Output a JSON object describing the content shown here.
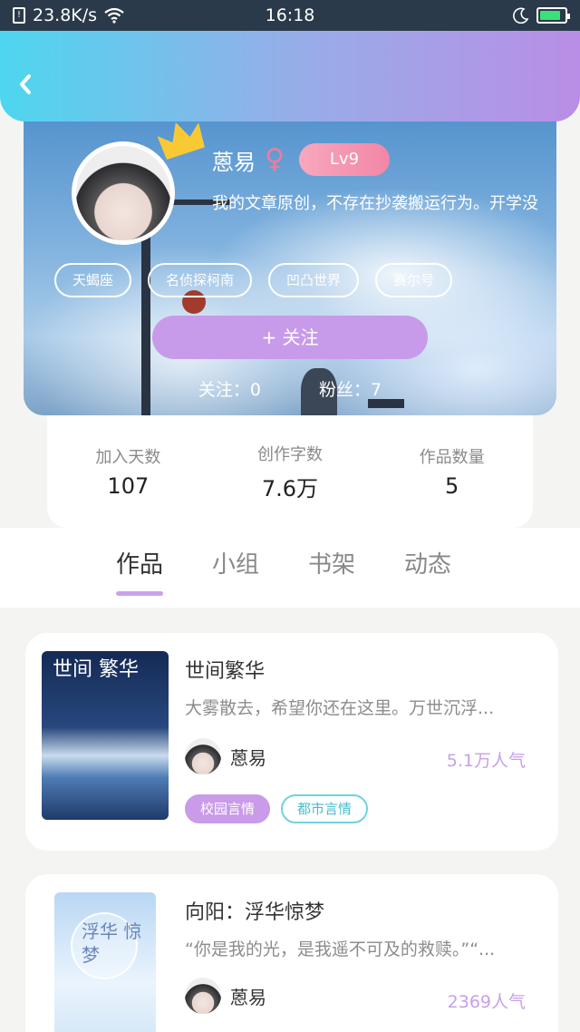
{
  "status_bar": {
    "network_speed": "23.8K/s",
    "time": "16:18",
    "battery_level": 0.85,
    "sim_icon": "sim-card-icon",
    "wifi_icon": "wifi-icon",
    "moon_icon": "moon-icon",
    "battery_icon": "battery-charging-icon"
  },
  "header": {
    "back_icon": "chevron-left-icon"
  },
  "profile": {
    "name": "蒽易",
    "gender_symbol": "♀",
    "level": "Lv9",
    "bio": "我的文章原创，不存在抄袭搬运行为。开学没",
    "tags": [
      "天蝎座",
      "名侦探柯南",
      "凹凸世界",
      "赛尔号"
    ],
    "follow_button": "+  关注",
    "following": "关注：0",
    "fans": "粉丝：7"
  },
  "stats": [
    {
      "label": "加入天数",
      "value": "107"
    },
    {
      "label": "创作字数",
      "value": "7.6万"
    },
    {
      "label": "作品数量",
      "value": "5"
    }
  ],
  "tabs": [
    "作品",
    "小组",
    "书架",
    "动态"
  ],
  "works": [
    {
      "title": "世间繁华",
      "description": "大雾散去，希望你还在这里。万世沉浮...",
      "cover_text": "世间 繁华",
      "author": "蒽易",
      "popularity": "5.1万人气",
      "tags": [
        "校园言情",
        "都市言情"
      ]
    },
    {
      "title": "向阳：浮华惊梦",
      "description": "“你是我的光，是我遥不可及的救赎。”“...",
      "cover_text": "浮华 惊梦",
      "author": "蒽易",
      "popularity": "2369人气"
    }
  ],
  "colors": {
    "header_start": "#4dd6ef",
    "header_end": "#b98ee6",
    "accent_purple": "#c99be9",
    "level_pink": "#f286a6",
    "tag_cyan": "#6ed3de"
  }
}
